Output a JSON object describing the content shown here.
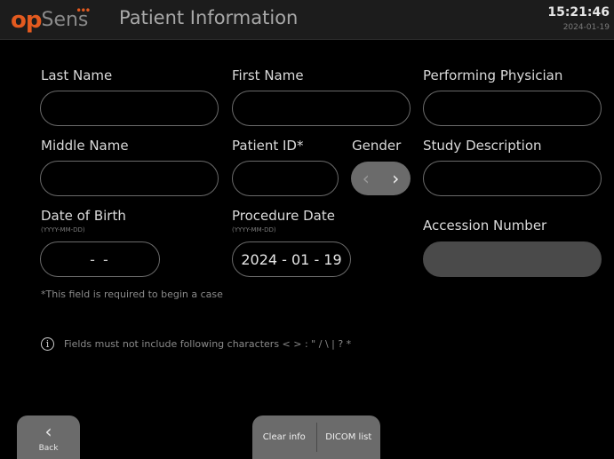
{
  "header": {
    "logo_op": "op",
    "logo_sens": "Sens",
    "title": "Patient Information",
    "time": "15:21:46",
    "date": "2024-01-19"
  },
  "form": {
    "last_name": {
      "label": "Last Name",
      "value": ""
    },
    "first_name": {
      "label": "First Name",
      "value": ""
    },
    "performing_physician": {
      "label": "Performing Physician",
      "value": ""
    },
    "middle_name": {
      "label": "Middle Name",
      "value": ""
    },
    "patient_id": {
      "label": "Patient ID*",
      "value": ""
    },
    "gender": {
      "label": "Gender",
      "prev": "‹",
      "next": "›"
    },
    "study_description": {
      "label": "Study Description",
      "value": ""
    },
    "date_of_birth": {
      "label": "Date of Birth",
      "format": "(YYYY-MM-DD)",
      "value": "-  -"
    },
    "procedure_date": {
      "label": "Procedure Date",
      "format": "(YYYY-MM-DD)",
      "value": "2024 - 01 - 19"
    },
    "accession_number": {
      "label": "Accession Number",
      "value": ""
    }
  },
  "notes": {
    "required": "*This field is required to begin a case",
    "info_glyph": "i",
    "invalid_chars": "Fields must not include following characters < > : \" / \\ | ? *"
  },
  "footer": {
    "back_label": "Back",
    "back_glyph": "‹",
    "clear_info": "Clear info",
    "dicom_list": "DICOM list"
  }
}
